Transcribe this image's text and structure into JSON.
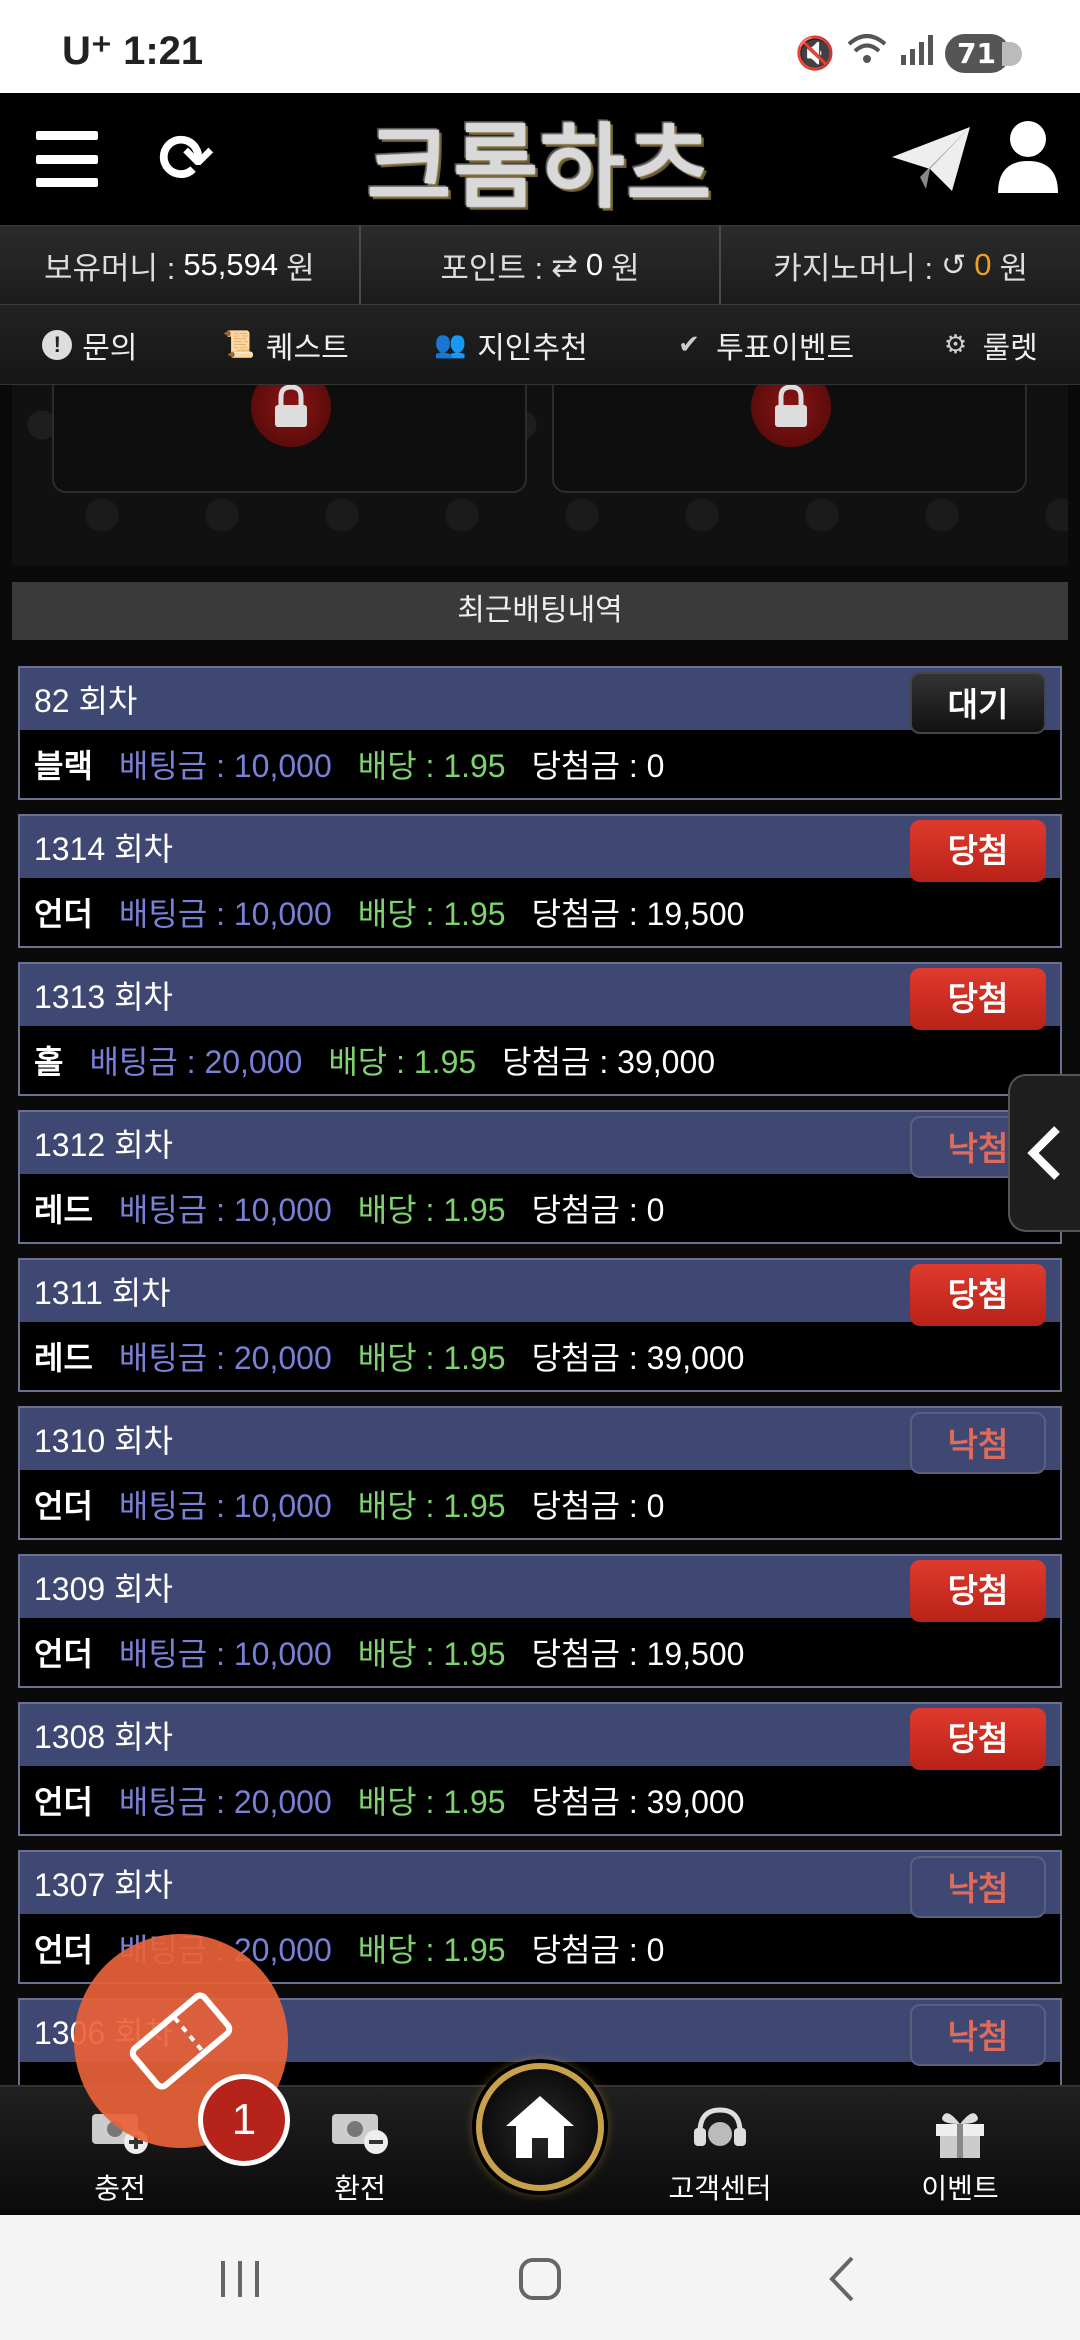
{
  "status_bar": {
    "carrier": "U⁺ 1:21",
    "battery": "71",
    "icons": [
      "mute-icon",
      "wifi-icon",
      "signal-icon"
    ]
  },
  "header": {
    "logo": "크롬하츠",
    "icons": [
      "menu-icon",
      "refresh-icon",
      "telegram-icon",
      "user-icon"
    ]
  },
  "money": {
    "holding_label": "보유머니 :",
    "holding_value": "55,594",
    "holding_unit": "원",
    "point_label": "포인트 :",
    "point_value": "0",
    "point_unit": "원",
    "casino_label": "카지노머니 :",
    "casino_value": "0",
    "casino_unit": "원"
  },
  "menu": [
    {
      "label": "문의",
      "icon": "info-icon"
    },
    {
      "label": "퀘스트",
      "icon": "quest-icon"
    },
    {
      "label": "지인추천",
      "icon": "people-icon"
    },
    {
      "label": "투표이벤트",
      "icon": "vote-icon"
    },
    {
      "label": "룰렛",
      "icon": "roulette-icon"
    }
  ],
  "section_title": "최근배팅내역",
  "bets": [
    {
      "round": "82 회차",
      "status": "대기",
      "status_type": "wait",
      "pick": "블랙",
      "amount": "배팅금 : 10,000",
      "odds": "배당 : 1.95",
      "win": "당첨금 : 0"
    },
    {
      "round": "1314 회차",
      "status": "당첨",
      "status_type": "win",
      "pick": "언더",
      "amount": "배팅금 : 10,000",
      "odds": "배당 : 1.95",
      "win": "당첨금 : 19,500"
    },
    {
      "round": "1313 회차",
      "status": "당첨",
      "status_type": "win",
      "pick": "홀",
      "amount": "배팅금 : 20,000",
      "odds": "배당 : 1.95",
      "win": "당첨금 : 39,000"
    },
    {
      "round": "1312 회차",
      "status": "낙첨",
      "status_type": "lose",
      "pick": "레드",
      "amount": "배팅금 : 10,000",
      "odds": "배당 : 1.95",
      "win": "당첨금 : 0"
    },
    {
      "round": "1311 회차",
      "status": "당첨",
      "status_type": "win",
      "pick": "레드",
      "amount": "배팅금 : 20,000",
      "odds": "배당 : 1.95",
      "win": "당첨금 : 39,000"
    },
    {
      "round": "1310 회차",
      "status": "낙첨",
      "status_type": "lose",
      "pick": "언더",
      "amount": "배팅금 : 10,000",
      "odds": "배당 : 1.95",
      "win": "당첨금 : 0"
    },
    {
      "round": "1309 회차",
      "status": "당첨",
      "status_type": "win",
      "pick": "언더",
      "amount": "배팅금 : 10,000",
      "odds": "배당 : 1.95",
      "win": "당첨금 : 19,500"
    },
    {
      "round": "1308 회차",
      "status": "당첨",
      "status_type": "win",
      "pick": "언더",
      "amount": "배팅금 : 20,000",
      "odds": "배당 : 1.95",
      "win": "당첨금 : 39,000"
    },
    {
      "round": "1307 회차",
      "status": "낙첨",
      "status_type": "lose",
      "pick": "언더",
      "amount": "배팅금 : 20,000",
      "odds": "배당 : 1.95",
      "win": "당첨금 : 0"
    },
    {
      "round": "1306 회차",
      "status": "낙첨",
      "status_type": "lose",
      "pick": "",
      "amount": "",
      "odds": "",
      "win": ""
    }
  ],
  "bottom_nav": [
    {
      "label": "충전",
      "icon": "charge-icon"
    },
    {
      "label": "환전",
      "icon": "exchange-icon"
    },
    {
      "label": "",
      "icon": "home-icon"
    },
    {
      "label": "고객센터",
      "icon": "support-icon"
    },
    {
      "label": "이벤트",
      "icon": "gift-icon"
    }
  ],
  "ticket_badge": "1",
  "colors": {
    "accent_gold": "#c8a24a",
    "win_red": "#e03a2e",
    "card_blue": "#3e4872",
    "amount_blue": "#7a80d6",
    "odds_green": "#7ed36f",
    "casino_orange": "#f0a020"
  }
}
